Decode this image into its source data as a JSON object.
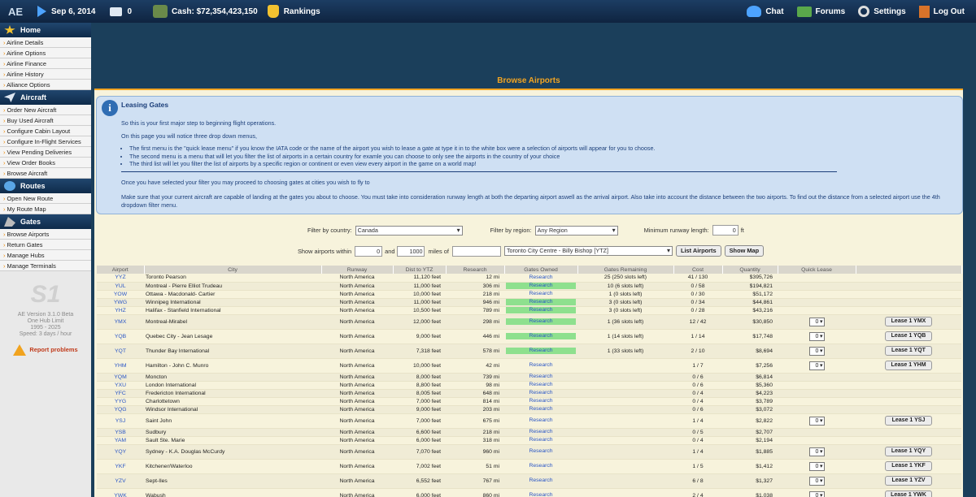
{
  "topbar": {
    "logo": "AE",
    "date": "Sep 6, 2014",
    "messages": "0",
    "cash": "Cash: $72,354,423,150",
    "rankings": "Rankings",
    "chat": "Chat",
    "forums": "Forums",
    "settings": "Settings",
    "logout": "Log Out"
  },
  "sidebar": {
    "home": {
      "title": "Home",
      "items": [
        "Airline Details",
        "Airline Options",
        "Airline Finance",
        "Airline History",
        "Alliance Options"
      ]
    },
    "aircraft": {
      "title": "Aircraft",
      "items": [
        "Order New Aircraft",
        "Buy Used Aircraft",
        "Configure Cabin Layout",
        "Configure In-Flight Services",
        "View Pending Deliveries",
        "View Order Books",
        "Browse Aircraft"
      ]
    },
    "routes": {
      "title": "Routes",
      "items": [
        "Open New Route",
        "My Route Map"
      ]
    },
    "gates": {
      "title": "Gates",
      "items": [
        "Browse Airports",
        "Return Gates",
        "Manage Hubs",
        "Manage Terminals"
      ]
    },
    "info": {
      "logo": "S1",
      "version": "AE Version 3.1.0 Beta",
      "limit": "One Hub Limit",
      "years": "1995 - 2025",
      "speed": "Speed: 3 days / hour",
      "report": "Report problems"
    }
  },
  "page": {
    "title": "Browse Airports"
  },
  "info": {
    "title": "Leasing Gates",
    "p1": "So this is your first major step to beginning flight operations.",
    "p2": "On this page you will notice three drop down menus,",
    "bullets": [
      "The first menu is the \"quick lease menu\" if you know the IATA code or the name of the airport you wish to lease a gate at type it in to the white box were a selection of airports will appear for you to choose.",
      "The second menu is a menu that will let you filter the list of airports in a certain country for examle you can choose to only see the airports in the country of your choice",
      "The third list will let you filter the list of airports by a specific region or continent or even view every airport in the game on a world map!"
    ],
    "p3": "Once you have selected your filter you may proceed to choosing gates at cities you wish to fly to",
    "p4": "Make sure that your current aircraft are capable of landing at the gates you about to choose. You must take into consideration runway length at both the departing airport aswell as the arrival airport. Also take into account the distance between the two airports. To find out the distance from a selected airport use the 4th dropdown filter menu."
  },
  "filters": {
    "country_label": "Filter by country:",
    "country_value": "Canada",
    "region_label": "Filter by region:",
    "region_value": "Any Region",
    "runway_label": "Minimum runway length:",
    "runway_value": "0",
    "runway_unit": "ft",
    "within_label": "Show airports within",
    "within_min": "0",
    "and_label": "and",
    "within_max": "1000",
    "miles_of_label": "miles of",
    "text_value": "",
    "from_airport": "Toronto City Centre - Billy Bishop [YTZ]",
    "list_btn": "List Airports",
    "map_btn": "Show Map"
  },
  "table": {
    "headers": [
      "Airport",
      "City",
      "Runway",
      "Dist to YTZ",
      "Research",
      "Gates Owned",
      "Gates Remaining",
      "Cost",
      "Quantity",
      "Quick Lease"
    ],
    "rows": [
      {
        "code": "YYZ",
        "city": "Toronto Pearson",
        "region": "North America",
        "runway": "11,120 feet",
        "dist": "12 mi",
        "research": "Research",
        "owned": false,
        "remaining": "25 (250 slots left)",
        "gates": "41 / 130",
        "cost": "$395,726",
        "qty": "",
        "lease": ""
      },
      {
        "code": "YUL",
        "city": "Montreal - Pierre Elliot Trudeau",
        "region": "North America",
        "runway": "11,000 feet",
        "dist": "306 mi",
        "research": "Research",
        "owned": true,
        "remaining": "10 (6 slots left)",
        "gates": "0 / 58",
        "cost": "$194,821",
        "qty": "",
        "lease": ""
      },
      {
        "code": "YOW",
        "city": "Ottawa - Macdonald- Cartier",
        "region": "North America",
        "runway": "10,000 feet",
        "dist": "218 mi",
        "research": "Research",
        "owned": false,
        "remaining": "1 (0 slots left)",
        "gates": "0 / 30",
        "cost": "$51,172",
        "qty": "",
        "lease": ""
      },
      {
        "code": "YWG",
        "city": "Winnipeg International",
        "region": "North America",
        "runway": "11,000 feet",
        "dist": "946 mi",
        "research": "Research",
        "owned": true,
        "remaining": "3 (0 slots left)",
        "gates": "0 / 34",
        "cost": "$44,861",
        "qty": "",
        "lease": ""
      },
      {
        "code": "YHZ",
        "city": "Halifax - Stanfield International",
        "region": "North America",
        "runway": "10,500 feet",
        "dist": "789 mi",
        "research": "Research",
        "owned": true,
        "remaining": "3 (0 slots left)",
        "gates": "0 / 28",
        "cost": "$43,216",
        "qty": "",
        "lease": ""
      },
      {
        "code": "YMX",
        "city": "Montreal-Mirabel",
        "region": "North America",
        "runway": "12,000 feet",
        "dist": "298 mi",
        "research": "Research",
        "owned": true,
        "remaining": "1 (36 slots left)",
        "gates": "12 / 42",
        "cost": "$30,850",
        "qty": "0",
        "lease": "Lease 1 YMX"
      },
      {
        "code": "YQB",
        "city": "Quebec City - Jean Lesage",
        "region": "North America",
        "runway": "9,000 feet",
        "dist": "446 mi",
        "research": "Research",
        "owned": true,
        "remaining": "1 (14 slots left)",
        "gates": "1 / 14",
        "cost": "$17,748",
        "qty": "0",
        "lease": "Lease 1 YQB"
      },
      {
        "code": "YQT",
        "city": "Thunder Bay International",
        "region": "North America",
        "runway": "7,318 feet",
        "dist": "578 mi",
        "research": "Research",
        "owned": true,
        "remaining": "1 (33 slots left)",
        "gates": "2 / 10",
        "cost": "$8,694",
        "qty": "0",
        "lease": "Lease 1 YQT"
      },
      {
        "code": "YHM",
        "city": "Hamilton - John C. Munro",
        "region": "North America",
        "runway": "10,000 feet",
        "dist": "42 mi",
        "research": "Research",
        "owned": false,
        "remaining": "",
        "gates": "1 / 7",
        "cost": "$7,256",
        "qty": "0",
        "lease": "Lease 1 YHM"
      },
      {
        "code": "YQM",
        "city": "Moncton",
        "region": "North America",
        "runway": "8,000 feet",
        "dist": "739 mi",
        "research": "Research",
        "owned": false,
        "remaining": "",
        "gates": "0 / 6",
        "cost": "$6,814",
        "qty": "",
        "lease": ""
      },
      {
        "code": "YXU",
        "city": "London International",
        "region": "North America",
        "runway": "8,800 feet",
        "dist": "98 mi",
        "research": "Research",
        "owned": false,
        "remaining": "",
        "gates": "0 / 6",
        "cost": "$5,360",
        "qty": "",
        "lease": ""
      },
      {
        "code": "YFC",
        "city": "Fredericton International",
        "region": "North America",
        "runway": "8,005 feet",
        "dist": "648 mi",
        "research": "Research",
        "owned": false,
        "remaining": "",
        "gates": "0 / 4",
        "cost": "$4,223",
        "qty": "",
        "lease": ""
      },
      {
        "code": "YYG",
        "city": "Charlottetown",
        "region": "North America",
        "runway": "7,000 feet",
        "dist": "814 mi",
        "research": "Research",
        "owned": false,
        "remaining": "",
        "gates": "0 / 4",
        "cost": "$3,789",
        "qty": "",
        "lease": ""
      },
      {
        "code": "YQG",
        "city": "Windsor International",
        "region": "North America",
        "runway": "9,000 feet",
        "dist": "203 mi",
        "research": "Research",
        "owned": false,
        "remaining": "",
        "gates": "0 / 6",
        "cost": "$3,072",
        "qty": "",
        "lease": ""
      },
      {
        "code": "YSJ",
        "city": "Saint John",
        "region": "North America",
        "runway": "7,000 feet",
        "dist": "675 mi",
        "research": "Research",
        "owned": false,
        "remaining": "",
        "gates": "1 / 4",
        "cost": "$2,822",
        "qty": "0",
        "lease": "Lease 1 YSJ"
      },
      {
        "code": "YSB",
        "city": "Sudbury",
        "region": "North America",
        "runway": "6,600 feet",
        "dist": "218 mi",
        "research": "Research",
        "owned": false,
        "remaining": "",
        "gates": "0 / 5",
        "cost": "$2,707",
        "qty": "",
        "lease": ""
      },
      {
        "code": "YAM",
        "city": "Sault Ste. Marie",
        "region": "North America",
        "runway": "6,000 feet",
        "dist": "318 mi",
        "research": "Research",
        "owned": false,
        "remaining": "",
        "gates": "0 / 4",
        "cost": "$2,194",
        "qty": "",
        "lease": ""
      },
      {
        "code": "YQY",
        "city": "Sydney - K.A. Douglas McCurdy",
        "region": "North America",
        "runway": "7,070 feet",
        "dist": "960 mi",
        "research": "Research",
        "owned": false,
        "remaining": "",
        "gates": "1 / 4",
        "cost": "$1,885",
        "qty": "0",
        "lease": "Lease 1 YQY"
      },
      {
        "code": "YKF",
        "city": "Kitchener/Waterloo",
        "region": "North America",
        "runway": "7,002 feet",
        "dist": "51 mi",
        "research": "Research",
        "owned": false,
        "remaining": "",
        "gates": "1 / 5",
        "cost": "$1,412",
        "qty": "0",
        "lease": "Lease 1 YKF"
      },
      {
        "code": "YZV",
        "city": "Sept-Iles",
        "region": "North America",
        "runway": "6,552 feet",
        "dist": "767 mi",
        "research": "Research",
        "owned": false,
        "remaining": "",
        "gates": "6 / 8",
        "cost": "$1,327",
        "qty": "0",
        "lease": "Lease 1 YZV"
      },
      {
        "code": "YWK",
        "city": "Wabush",
        "region": "North America",
        "runway": "6,000 feet",
        "dist": "860 mi",
        "research": "Research",
        "owned": false,
        "remaining": "",
        "gates": "2 / 4",
        "cost": "$1,038",
        "qty": "0",
        "lease": "Lease 1 YWK"
      }
    ]
  }
}
